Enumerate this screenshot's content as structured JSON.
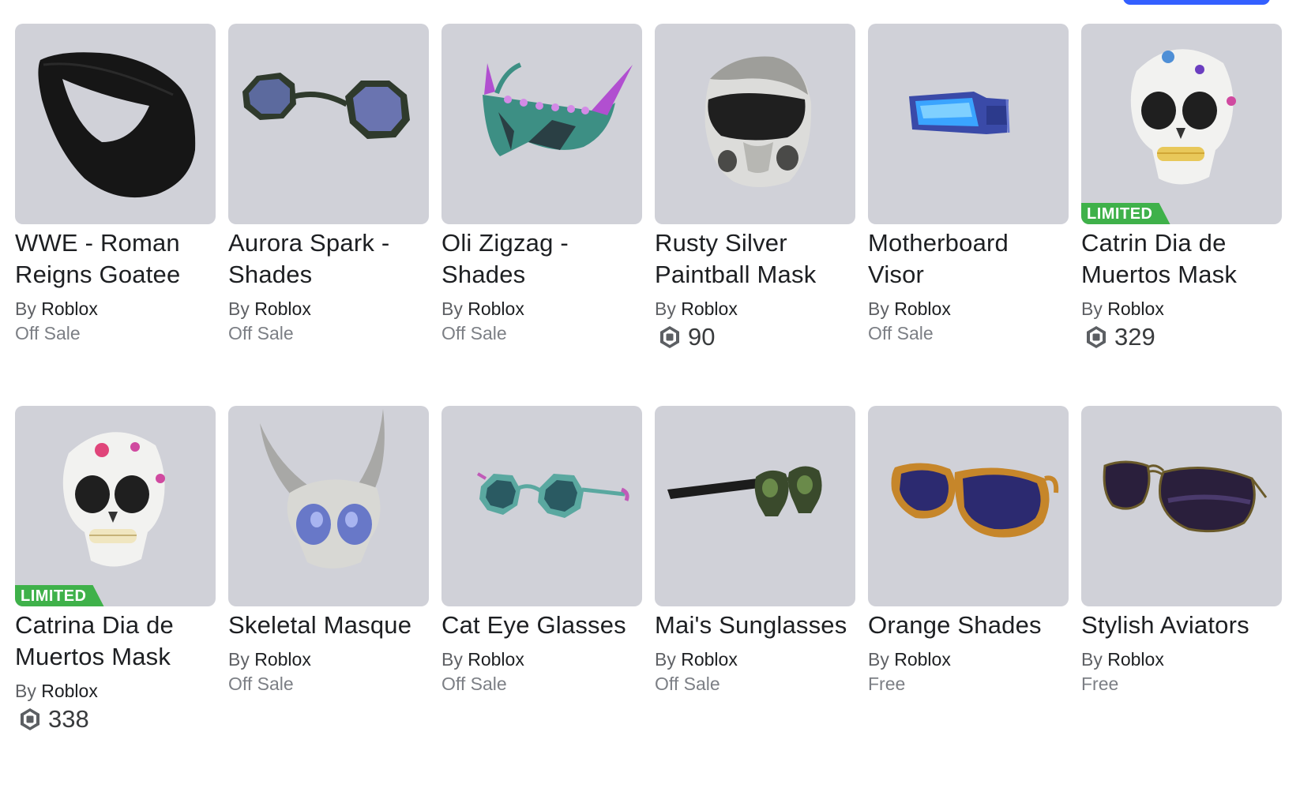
{
  "items": [
    {
      "name": "WWE - Roman Reigns Goatee",
      "by": "By",
      "creator": "Roblox",
      "price": "Off Sale",
      "robux": null,
      "limited": null,
      "icon": "goatee-mask-icon"
    },
    {
      "name": "Aurora Spark - Shades",
      "by": "By",
      "creator": "Roblox",
      "price": "Off Sale",
      "robux": null,
      "limited": null,
      "icon": "round-shades-icon"
    },
    {
      "name": "Oli Zigzag - Shades",
      "by": "By",
      "creator": "Roblox",
      "price": "Off Sale",
      "robux": null,
      "limited": null,
      "icon": "spiked-shades-icon"
    },
    {
      "name": "Rusty Silver Paintball Mask",
      "by": "By",
      "creator": "Roblox",
      "price": null,
      "robux": "90",
      "limited": null,
      "icon": "paintball-mask-icon"
    },
    {
      "name": "Motherboard Visor",
      "by": "By",
      "creator": "Roblox",
      "price": "Off Sale",
      "robux": null,
      "limited": null,
      "icon": "visor-icon"
    },
    {
      "name": "Catrin Dia de Muertos Mask",
      "by": "By",
      "creator": "Roblox",
      "price": null,
      "robux": "329",
      "limited": "LIMITED",
      "icon": "sugar-skull-icon"
    },
    {
      "name": "Catrina Dia de Muertos Mask",
      "by": "By",
      "creator": "Roblox",
      "price": null,
      "robux": "338",
      "limited": "LIMITED",
      "icon": "sugar-skull-pink-icon"
    },
    {
      "name": "Skeletal Masque",
      "by": "By",
      "creator": "Roblox",
      "price": "Off Sale",
      "robux": null,
      "limited": null,
      "icon": "horned-skull-icon"
    },
    {
      "name": "Cat Eye Glasses",
      "by": "By",
      "creator": "Roblox",
      "price": "Off Sale",
      "robux": null,
      "limited": null,
      "icon": "cat-eye-glasses-icon"
    },
    {
      "name": "Mai's Sunglasses",
      "by": "By",
      "creator": "Roblox",
      "price": "Off Sale",
      "robux": null,
      "limited": null,
      "icon": "skull-sunglasses-icon"
    },
    {
      "name": "Orange Shades",
      "by": "By",
      "creator": "Roblox",
      "price": "Free",
      "robux": null,
      "limited": null,
      "icon": "orange-shades-icon"
    },
    {
      "name": "Stylish Aviators",
      "by": "By",
      "creator": "Roblox",
      "price": "Free",
      "robux": null,
      "limited": null,
      "icon": "aviators-icon"
    }
  ],
  "colors": {
    "thumb_bg": "#d0d1d8",
    "limited_badge": "#3fb14a",
    "top_button": "#335fff"
  }
}
